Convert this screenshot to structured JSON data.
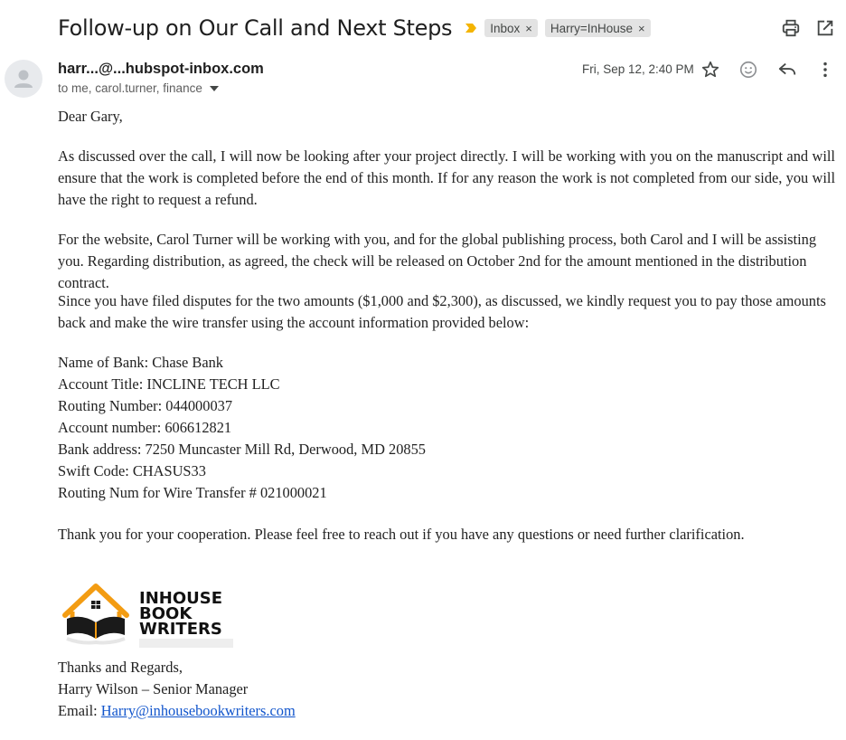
{
  "email": {
    "subject": "Follow-up on Our Call and Next Steps",
    "labels": [
      {
        "name": "Inbox",
        "close": "×"
      },
      {
        "name": "Harry=InHouse",
        "close": "×"
      }
    ],
    "sender": "harr...@...hubspot-inbox.com",
    "recipients": "to me, carol.turner, finance",
    "date": "Fri, Sep 12, 2:40 PM",
    "body": {
      "greeting": "Dear Gary,",
      "paragraphs": [
        "As discussed over the call, I will now be looking after your project directly. I will be working with you on the manuscript and will ensure that the work is completed before the end of this month. If for any reason the work is not completed from our side, you will have the right to request a refund.",
        "For the website, Carol Turner will be working with you, and for the global publishing process, both Carol and I will be assisting you. Regarding distribution, as agreed, the check will be released on October 2nd for the amount mentioned in the distribution contract.",
        "Since you have filed disputes for the two amounts ($1,000 and $2,300), as discussed, we kindly request you to pay those amounts back and make the wire transfer using the account information provided below:"
      ],
      "bank_details": [
        "Name of Bank: Chase Bank",
        "Account Title: INCLINE TECH LLC",
        "Routing Number: 044000037",
        "Account number: 606612821",
        "Bank address: 7250 Muncaster Mill Rd, Derwood, MD 20855",
        "Swift Code: CHASUS33",
        "Routing Num for Wire Transfer # 021000021"
      ],
      "thanks": "Thank you for your cooperation. Please feel free to reach out if you have any questions or need further clarification.",
      "logo_text": [
        "INHOUSE",
        "BOOK",
        "WRITERS"
      ],
      "closing": "Thanks and Regards,",
      "signature": "Harry Wilson – Senior Manager",
      "email_label": "Email: ",
      "email_address": "Harry@inhousebookwriters.com"
    }
  },
  "icons": {
    "importance": "importance-marker-icon",
    "print": "print-icon",
    "open_new_window": "open-in-new-window-icon",
    "star": "star-icon",
    "emoji": "emoji-reaction-icon",
    "reply": "reply-icon",
    "more": "more-vert-icon"
  },
  "colors": {
    "importance": "#f4b400",
    "logo_orange": "#f39c12",
    "link": "#1155cc"
  }
}
